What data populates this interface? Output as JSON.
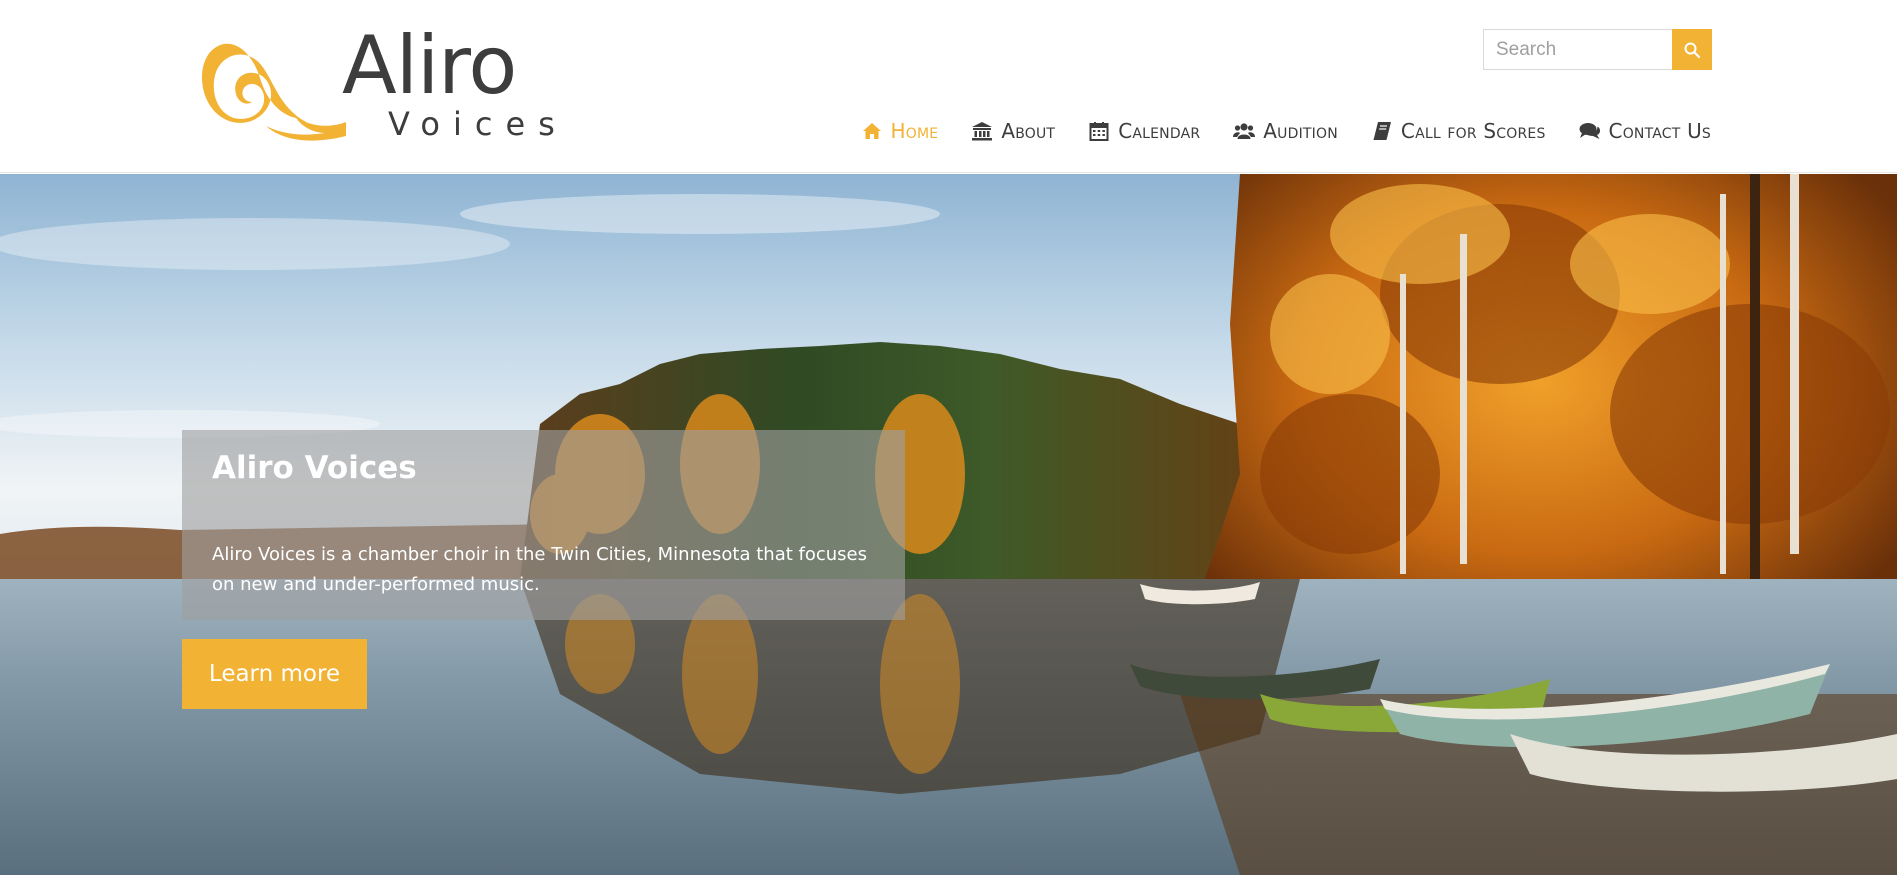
{
  "brand": {
    "name": "Aliro",
    "tagline": "Voices",
    "accent_color": "#f2b233",
    "text_color": "#3d3d3d"
  },
  "search": {
    "placeholder": "Search",
    "value": "",
    "button_icon": "search-icon"
  },
  "nav": {
    "items": [
      {
        "label": "Home",
        "icon": "home-icon",
        "active": true
      },
      {
        "label": "About",
        "icon": "bank-icon",
        "active": false
      },
      {
        "label": "Calendar",
        "icon": "calendar-icon",
        "active": false
      },
      {
        "label": "Audition",
        "icon": "users-icon",
        "active": false
      },
      {
        "label": "Call for Scores",
        "icon": "book-icon",
        "active": false
      },
      {
        "label": "Contact Us",
        "icon": "comments-icon",
        "active": false
      }
    ]
  },
  "hero": {
    "title": "Aliro Voices",
    "text": "Aliro Voices is a chamber choir in the Twin Cities, Minnesota that focuses on new and under-performed music.",
    "button_label": "Learn more"
  }
}
